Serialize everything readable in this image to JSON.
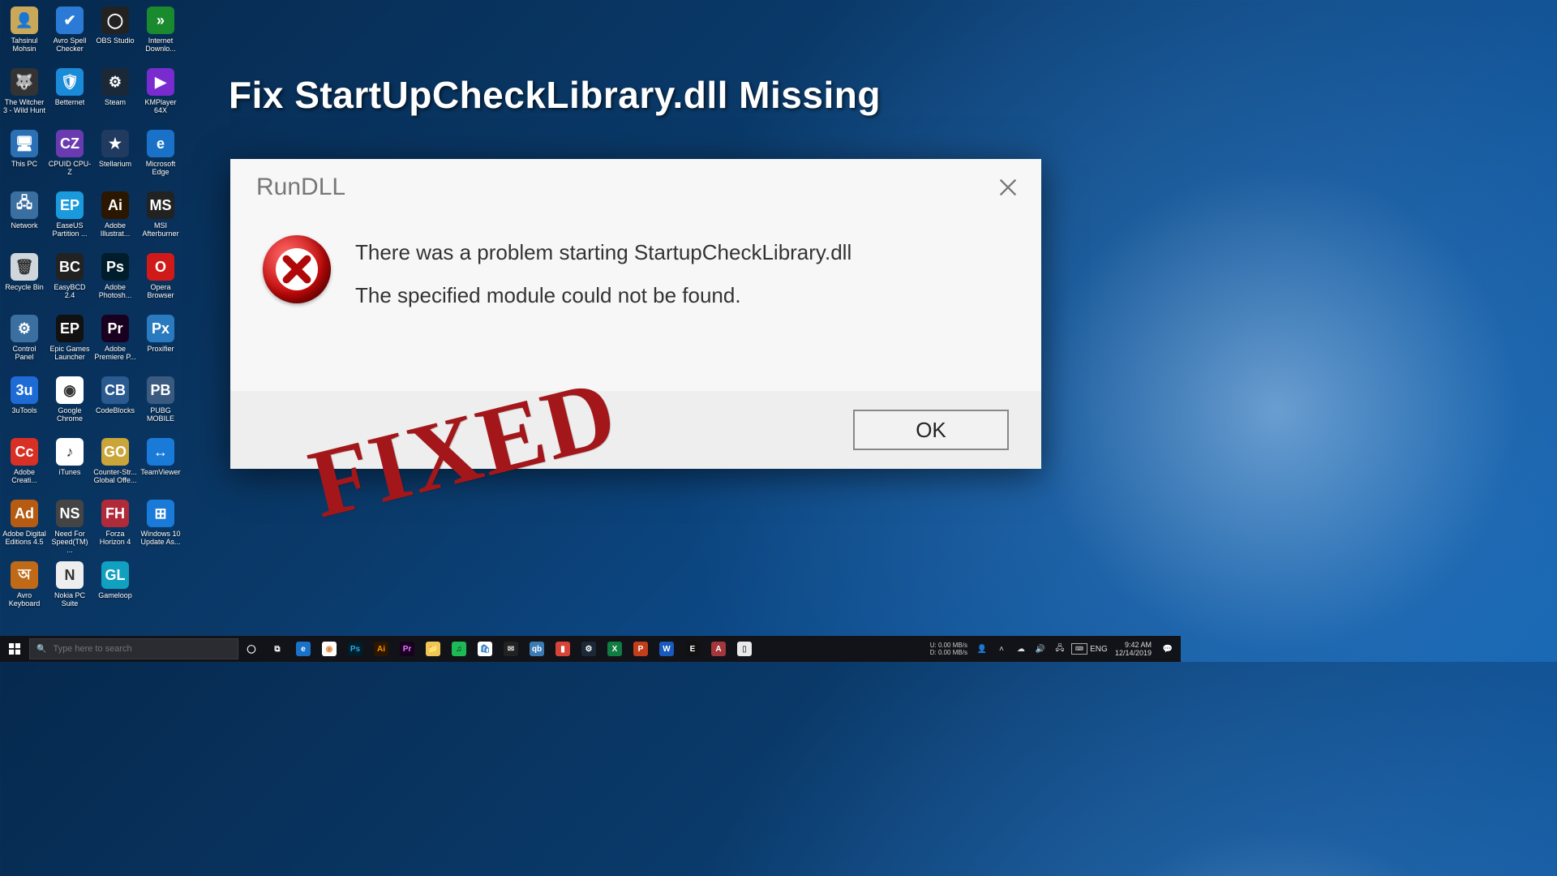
{
  "headline": "Fix StartUpCheckLibrary.dll Missing",
  "stamp": "FIXED",
  "dialog": {
    "title": "RunDLL",
    "msg1": "There was a problem starting StartupCheckLibrary.dll",
    "msg2": "The specified module could not be found.",
    "ok": "OK"
  },
  "search": {
    "placeholder": "Type here to search"
  },
  "net": {
    "u_label": "U:",
    "d_label": "D:",
    "u_rate": "0.00 MB/s",
    "d_rate": "0.00 MB/s"
  },
  "lang": "ENG",
  "clock": {
    "time": "9:42 AM",
    "date": "12/14/2019"
  },
  "icons": {
    "c0": [
      {
        "label": "Tahsinul Mohsin",
        "bg": "#caa85a",
        "glyph": "👤"
      },
      {
        "label": "The Witcher 3 - Wild Hunt",
        "bg": "#333",
        "glyph": "🐺"
      },
      {
        "label": "This PC",
        "bg": "#2b6fb5",
        "glyph": "🖥"
      },
      {
        "label": "Network",
        "bg": "#3a6fa0",
        "glyph": "🖧"
      },
      {
        "label": "Recycle Bin",
        "bg": "#cfd6dc",
        "glyph": "🗑"
      },
      {
        "label": "Control Panel",
        "bg": "#3a6fa0",
        "glyph": "⚙"
      },
      {
        "label": "3uTools",
        "bg": "#1e6bd6",
        "glyph": "3u"
      },
      {
        "label": "Adobe Creati...",
        "bg": "#d83024",
        "glyph": "Cc"
      },
      {
        "label": "Adobe Digital Editions 4.5",
        "bg": "#b75a12",
        "glyph": "Ad"
      },
      {
        "label": "Avro Keyboard",
        "bg": "#c06a18",
        "glyph": "অ"
      }
    ],
    "c1": [
      {
        "label": "Avro Spell Checker",
        "bg": "#2b7bd6",
        "glyph": "✔"
      },
      {
        "label": "Betternet",
        "bg": "#1a8bd8",
        "glyph": "🛡"
      },
      {
        "label": "CPUID CPU-Z",
        "bg": "#6a3bb0",
        "glyph": "CZ"
      },
      {
        "label": "EaseUS Partition ...",
        "bg": "#1a9adc",
        "glyph": "EP"
      },
      {
        "label": "EasyBCD 2.4",
        "bg": "#222",
        "glyph": "BC"
      },
      {
        "label": "Epic Games Launcher",
        "bg": "#111",
        "glyph": "EP"
      },
      {
        "label": "Google Chrome",
        "bg": "#fff",
        "glyph": "◉"
      },
      {
        "label": "iTunes",
        "bg": "#fff",
        "glyph": "♪"
      },
      {
        "label": "Need For Speed(TM) ...",
        "bg": "#444",
        "glyph": "NS"
      },
      {
        "label": "Nokia PC Suite",
        "bg": "#eee",
        "glyph": "N"
      }
    ],
    "c2": [
      {
        "label": "OBS Studio",
        "bg": "#222",
        "glyph": "◯"
      },
      {
        "label": "Steam",
        "bg": "#1a2838",
        "glyph": "⚙"
      },
      {
        "label": "Stellarium",
        "bg": "#203a60",
        "glyph": "★"
      },
      {
        "label": "Adobe Illustrat...",
        "bg": "#2b1600",
        "glyph": "Ai"
      },
      {
        "label": "Adobe Photosh...",
        "bg": "#001d2b",
        "glyph": "Ps"
      },
      {
        "label": "Adobe Premiere P...",
        "bg": "#1a0020",
        "glyph": "Pr"
      },
      {
        "label": "CodeBlocks",
        "bg": "#2a5a90",
        "glyph": "CB"
      },
      {
        "label": "Counter-Str... Global Offe...",
        "bg": "#caa53a",
        "glyph": "GO"
      },
      {
        "label": "Forza Horizon 4",
        "bg": "#b02a3a",
        "glyph": "FH"
      },
      {
        "label": "Gameloop",
        "bg": "#11a0c0",
        "glyph": "GL"
      }
    ],
    "c3": [
      {
        "label": "Internet Downlo...",
        "bg": "#1a8a2e",
        "glyph": "»"
      },
      {
        "label": "KMPlayer 64X",
        "bg": "#7a2bd0",
        "glyph": "▶"
      },
      {
        "label": "Microsoft Edge",
        "bg": "#1a72c8",
        "glyph": "e"
      },
      {
        "label": "MSI Afterburner",
        "bg": "#222",
        "glyph": "MS"
      },
      {
        "label": "Opera Browser",
        "bg": "#d01a1a",
        "glyph": "O"
      },
      {
        "label": "Proxifier",
        "bg": "#2a7ac0",
        "glyph": "Px"
      },
      {
        "label": "PUBG MOBILE",
        "bg": "#3a5a80",
        "glyph": "PB"
      },
      {
        "label": "TeamViewer",
        "bg": "#1a7ad8",
        "glyph": "↔"
      },
      {
        "label": "Windows 10 Update As...",
        "bg": "#1a7ad8",
        "glyph": "⊞"
      }
    ]
  },
  "taskbar_apps": [
    {
      "name": "cortana",
      "bg": "transparent",
      "fg": "#fff",
      "glyph": "◯"
    },
    {
      "name": "task-view",
      "bg": "transparent",
      "fg": "#fff",
      "glyph": "⧉"
    },
    {
      "name": "edge",
      "bg": "#1a72c8",
      "fg": "#fff",
      "glyph": "e"
    },
    {
      "name": "chrome",
      "bg": "#fff",
      "fg": "#d84",
      "glyph": "◉"
    },
    {
      "name": "photoshop",
      "bg": "#001d2b",
      "fg": "#29abe2",
      "glyph": "Ps"
    },
    {
      "name": "illustrator",
      "bg": "#2b1600",
      "fg": "#ff9a00",
      "glyph": "Ai"
    },
    {
      "name": "premiere",
      "bg": "#1a0020",
      "fg": "#ea77ff",
      "glyph": "Pr"
    },
    {
      "name": "file-explorer",
      "bg": "#f0c756",
      "fg": "#555",
      "glyph": "📁"
    },
    {
      "name": "spotify",
      "bg": "#1db954",
      "fg": "#111",
      "glyph": "♫"
    },
    {
      "name": "store",
      "bg": "#fff",
      "fg": "#2a7ac0",
      "glyph": "🛍"
    },
    {
      "name": "mail",
      "bg": "#222",
      "fg": "#ddd",
      "glyph": "✉"
    },
    {
      "name": "qbittorrent",
      "bg": "#3a7bb5",
      "fg": "#fff",
      "glyph": "qb"
    },
    {
      "name": "todoist",
      "bg": "#d84338",
      "fg": "#fff",
      "glyph": "▮"
    },
    {
      "name": "steam",
      "bg": "#1a2838",
      "fg": "#fff",
      "glyph": "⚙"
    },
    {
      "name": "excel",
      "bg": "#107c41",
      "fg": "#fff",
      "glyph": "X"
    },
    {
      "name": "powerpoint",
      "bg": "#c43e1c",
      "fg": "#fff",
      "glyph": "P"
    },
    {
      "name": "word",
      "bg": "#185abd",
      "fg": "#fff",
      "glyph": "W"
    },
    {
      "name": "epic",
      "bg": "#111",
      "fg": "#fff",
      "glyph": "E"
    },
    {
      "name": "access",
      "bg": "#a4373a",
      "fg": "#fff",
      "glyph": "A"
    },
    {
      "name": "notepad",
      "bg": "#eaeaea",
      "fg": "#555",
      "glyph": "▯"
    }
  ]
}
